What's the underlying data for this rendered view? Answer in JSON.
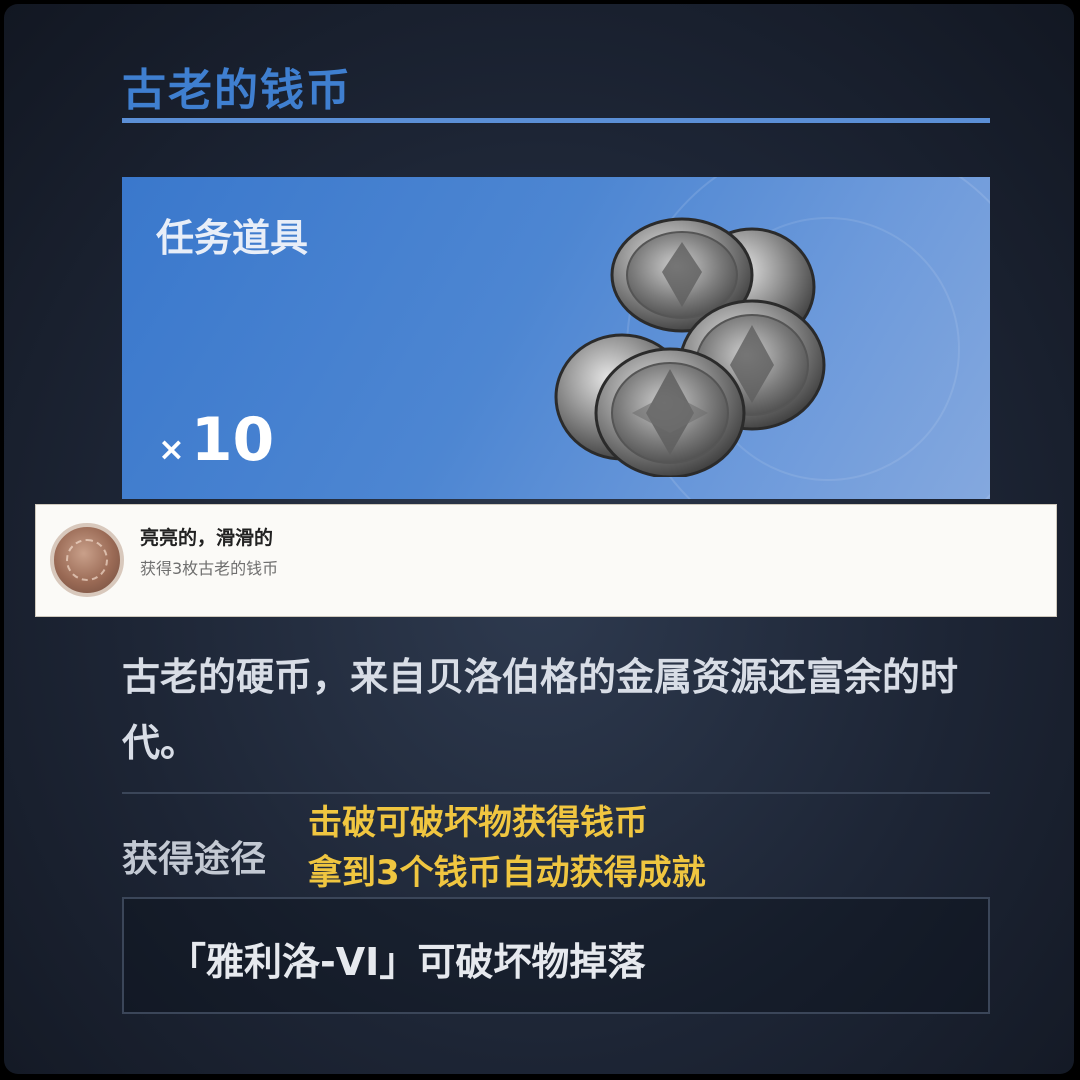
{
  "item": {
    "title": "古老的钱币",
    "category": "任务道具",
    "quantity_prefix": "×",
    "quantity": "10",
    "icon": "silver-coins-icon"
  },
  "achievement_toast": {
    "icon": "achievement-medal-icon",
    "title": "亮亮的，滑滑的",
    "subtitle": "获得3枚古老的钱币"
  },
  "description": "古老的硬币，来自贝洛伯格的金属资源还富余的时代。",
  "acquisition": {
    "label": "获得途径",
    "source": "「雅利洛-VI」可破坏物掉落"
  },
  "overlay_note": {
    "lines": [
      "击破可破坏物获得钱币",
      "拿到3个钱币自动获得成就"
    ],
    "color": "#f0c640"
  },
  "colors": {
    "accent": "#3f7fd0",
    "banner": "#4d86d2"
  }
}
